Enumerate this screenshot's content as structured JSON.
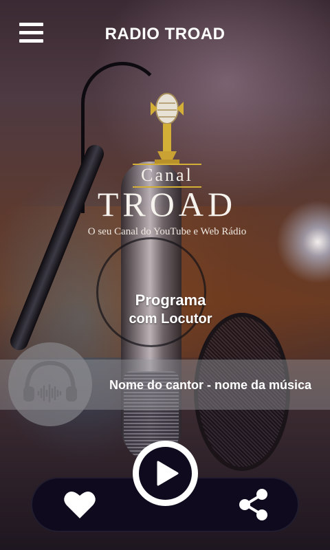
{
  "header": {
    "title": "RADIO TROAD",
    "menu_icon": "hamburger-menu-icon"
  },
  "logo": {
    "canal": "Canal",
    "name": "TROAD",
    "tagline": "O seu Canal do YouTube e Web Rádio"
  },
  "program": {
    "title": "Programa",
    "subtitle": "com Locutor"
  },
  "now_playing": {
    "song": "Nome do cantor - nome da música",
    "cover_icon": "headphones-icon"
  },
  "controls": {
    "like_icon": "heart-icon",
    "play_icon": "play-icon",
    "share_icon": "share-icon"
  },
  "colors": {
    "control_bar": "#0f0a1e",
    "text": "#ffffff",
    "logo_gold": "#d4af37"
  }
}
